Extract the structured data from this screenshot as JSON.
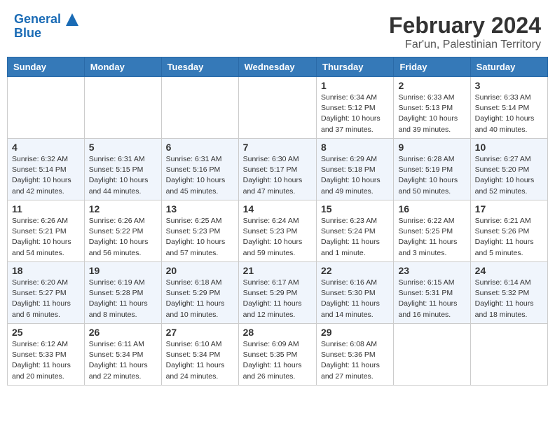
{
  "logo": {
    "line1": "General",
    "line2": "Blue"
  },
  "title": "February 2024",
  "subtitle": "Far'un, Palestinian Territory",
  "days_header": [
    "Sunday",
    "Monday",
    "Tuesday",
    "Wednesday",
    "Thursday",
    "Friday",
    "Saturday"
  ],
  "weeks": [
    [
      {
        "day": "",
        "info": ""
      },
      {
        "day": "",
        "info": ""
      },
      {
        "day": "",
        "info": ""
      },
      {
        "day": "",
        "info": ""
      },
      {
        "day": "1",
        "info": "Sunrise: 6:34 AM\nSunset: 5:12 PM\nDaylight: 10 hours and 37 minutes."
      },
      {
        "day": "2",
        "info": "Sunrise: 6:33 AM\nSunset: 5:13 PM\nDaylight: 10 hours and 39 minutes."
      },
      {
        "day": "3",
        "info": "Sunrise: 6:33 AM\nSunset: 5:14 PM\nDaylight: 10 hours and 40 minutes."
      }
    ],
    [
      {
        "day": "4",
        "info": "Sunrise: 6:32 AM\nSunset: 5:14 PM\nDaylight: 10 hours and 42 minutes."
      },
      {
        "day": "5",
        "info": "Sunrise: 6:31 AM\nSunset: 5:15 PM\nDaylight: 10 hours and 44 minutes."
      },
      {
        "day": "6",
        "info": "Sunrise: 6:31 AM\nSunset: 5:16 PM\nDaylight: 10 hours and 45 minutes."
      },
      {
        "day": "7",
        "info": "Sunrise: 6:30 AM\nSunset: 5:17 PM\nDaylight: 10 hours and 47 minutes."
      },
      {
        "day": "8",
        "info": "Sunrise: 6:29 AM\nSunset: 5:18 PM\nDaylight: 10 hours and 49 minutes."
      },
      {
        "day": "9",
        "info": "Sunrise: 6:28 AM\nSunset: 5:19 PM\nDaylight: 10 hours and 50 minutes."
      },
      {
        "day": "10",
        "info": "Sunrise: 6:27 AM\nSunset: 5:20 PM\nDaylight: 10 hours and 52 minutes."
      }
    ],
    [
      {
        "day": "11",
        "info": "Sunrise: 6:26 AM\nSunset: 5:21 PM\nDaylight: 10 hours and 54 minutes."
      },
      {
        "day": "12",
        "info": "Sunrise: 6:26 AM\nSunset: 5:22 PM\nDaylight: 10 hours and 56 minutes."
      },
      {
        "day": "13",
        "info": "Sunrise: 6:25 AM\nSunset: 5:23 PM\nDaylight: 10 hours and 57 minutes."
      },
      {
        "day": "14",
        "info": "Sunrise: 6:24 AM\nSunset: 5:23 PM\nDaylight: 10 hours and 59 minutes."
      },
      {
        "day": "15",
        "info": "Sunrise: 6:23 AM\nSunset: 5:24 PM\nDaylight: 11 hours and 1 minute."
      },
      {
        "day": "16",
        "info": "Sunrise: 6:22 AM\nSunset: 5:25 PM\nDaylight: 11 hours and 3 minutes."
      },
      {
        "day": "17",
        "info": "Sunrise: 6:21 AM\nSunset: 5:26 PM\nDaylight: 11 hours and 5 minutes."
      }
    ],
    [
      {
        "day": "18",
        "info": "Sunrise: 6:20 AM\nSunset: 5:27 PM\nDaylight: 11 hours and 6 minutes."
      },
      {
        "day": "19",
        "info": "Sunrise: 6:19 AM\nSunset: 5:28 PM\nDaylight: 11 hours and 8 minutes."
      },
      {
        "day": "20",
        "info": "Sunrise: 6:18 AM\nSunset: 5:29 PM\nDaylight: 11 hours and 10 minutes."
      },
      {
        "day": "21",
        "info": "Sunrise: 6:17 AM\nSunset: 5:29 PM\nDaylight: 11 hours and 12 minutes."
      },
      {
        "day": "22",
        "info": "Sunrise: 6:16 AM\nSunset: 5:30 PM\nDaylight: 11 hours and 14 minutes."
      },
      {
        "day": "23",
        "info": "Sunrise: 6:15 AM\nSunset: 5:31 PM\nDaylight: 11 hours and 16 minutes."
      },
      {
        "day": "24",
        "info": "Sunrise: 6:14 AM\nSunset: 5:32 PM\nDaylight: 11 hours and 18 minutes."
      }
    ],
    [
      {
        "day": "25",
        "info": "Sunrise: 6:12 AM\nSunset: 5:33 PM\nDaylight: 11 hours and 20 minutes."
      },
      {
        "day": "26",
        "info": "Sunrise: 6:11 AM\nSunset: 5:34 PM\nDaylight: 11 hours and 22 minutes."
      },
      {
        "day": "27",
        "info": "Sunrise: 6:10 AM\nSunset: 5:34 PM\nDaylight: 11 hours and 24 minutes."
      },
      {
        "day": "28",
        "info": "Sunrise: 6:09 AM\nSunset: 5:35 PM\nDaylight: 11 hours and 26 minutes."
      },
      {
        "day": "29",
        "info": "Sunrise: 6:08 AM\nSunset: 5:36 PM\nDaylight: 11 hours and 27 minutes."
      },
      {
        "day": "",
        "info": ""
      },
      {
        "day": "",
        "info": ""
      }
    ]
  ]
}
